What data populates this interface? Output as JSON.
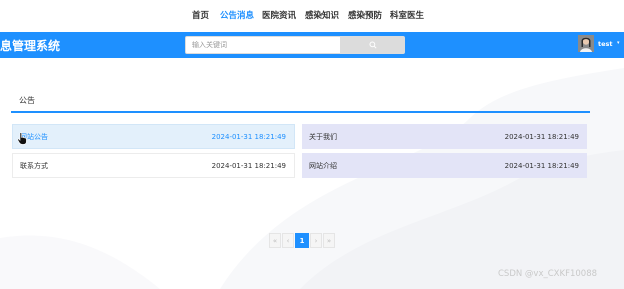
{
  "nav": {
    "items": [
      {
        "label": "首页"
      },
      {
        "label": "公告消息",
        "active": true
      },
      {
        "label": "医院资讯"
      },
      {
        "label": "感染知识"
      },
      {
        "label": "感染预防"
      },
      {
        "label": "科室医生"
      }
    ]
  },
  "header": {
    "brand": "息管理系统",
    "search_placeholder": "输入关键词",
    "search_value": "",
    "user_name": "test",
    "caret": "▾"
  },
  "section": {
    "title": "公告"
  },
  "list": [
    {
      "title": "网站公告",
      "date": "2024-01-31 18:21:49",
      "hovered": true
    },
    {
      "title": "关于我们",
      "date": "2024-01-31 18:21:49"
    },
    {
      "title": "联系方式",
      "date": "2024-01-31 18:21:49"
    },
    {
      "title": "网站介绍",
      "date": "2024-01-31 18:21:49"
    }
  ],
  "pagination": {
    "first": "«",
    "prev": "‹",
    "current": "1",
    "next": "›",
    "last": "»"
  },
  "watermark": "CSDN @vx_CXKF10088",
  "colors": {
    "primary": "#1e90ff",
    "card_blue": "#e3f0fb",
    "card_lavender": "#e3e4f7"
  }
}
